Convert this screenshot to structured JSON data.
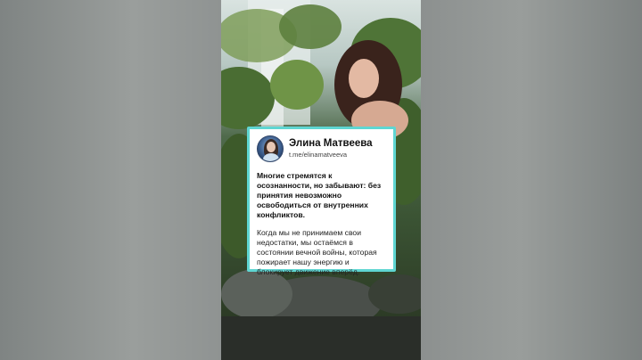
{
  "post": {
    "author_name": "Элина Матвеева",
    "author_handle": "t.me/elinamatveeva",
    "lead_text": "Многие стремятся к осознанности, но забывают: без принятия невозможно освободиться от внутренних конфликтов.",
    "body_text": "Когда мы не принимаем свои недостатки, мы остаёмся в состоянии вечной войны, которая пожирает нашу энергию и блокирует движение вперёд."
  },
  "colors": {
    "card_border": "#5fd6d2",
    "card_background": "#ffffff",
    "side_background": "#8e9291"
  },
  "icons": {
    "avatar": "author-avatar-photo"
  }
}
